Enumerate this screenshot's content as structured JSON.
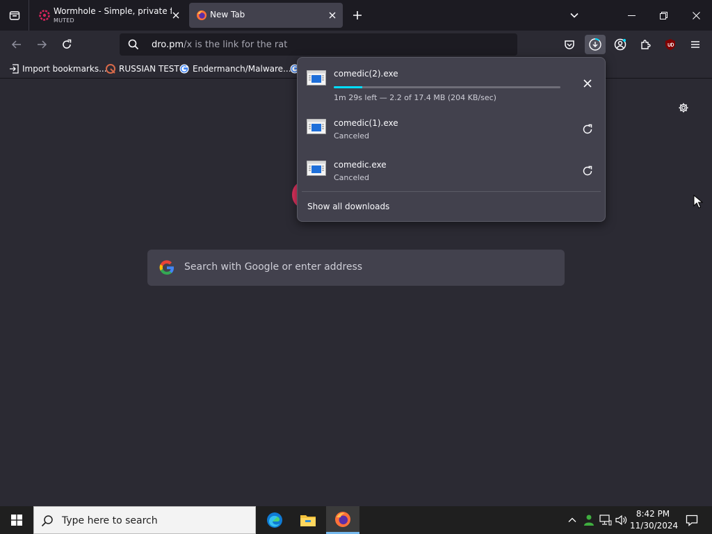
{
  "tabs": [
    {
      "title": "Wormhole - Simple, private file sharing",
      "subtitle": "MUTED",
      "favicon": "wormhole-icon"
    },
    {
      "title": "New Tab",
      "favicon": "firefox-icon"
    }
  ],
  "toolbar": {
    "url_host": "dro.pm",
    "url_rest": "/x is the link for the rat"
  },
  "bookmarks": [
    {
      "label": "Import bookmarks...",
      "icon": "import-icon"
    },
    {
      "label": "RUSSIAN TEST",
      "icon": "search-engine-icon"
    },
    {
      "label": "Endermanch/Malware...",
      "icon": "google-icon"
    }
  ],
  "newtab": {
    "search_placeholder": "Search with Google or enter address"
  },
  "downloads": {
    "items": [
      {
        "name": "comedic(2).exe",
        "status": "1m 29s left — 2.2 of 17.4 MB (204 KB/sec)",
        "progress": 0.126,
        "action": "cancel"
      },
      {
        "name": "comedic(1).exe",
        "status": "Canceled",
        "action": "retry"
      },
      {
        "name": "comedic.exe",
        "status": "Canceled",
        "action": "retry"
      }
    ],
    "show_all": "Show all downloads"
  },
  "taskbar": {
    "search_placeholder": "Type here to search",
    "time": "8:42 PM",
    "date": "11/30/2024"
  },
  "colors": {
    "accent": "#00ddff",
    "tab_bg": "#1c1b22",
    "toolbar_bg": "#2b2a33",
    "panel_bg": "#42414d"
  }
}
